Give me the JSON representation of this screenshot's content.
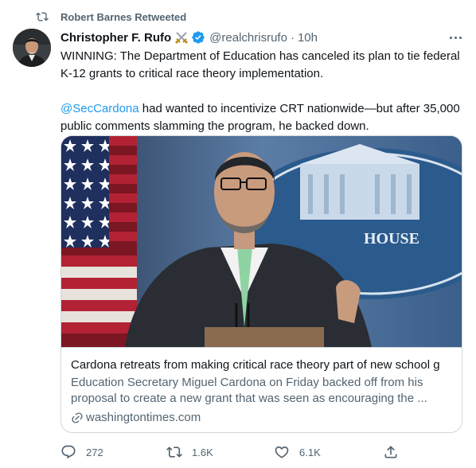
{
  "retweet": {
    "icon": "retweet-icon",
    "text": "Robert Barnes Retweeted"
  },
  "tweet": {
    "author_name": "Christopher F. Rufo",
    "author_emoji": "crossed-swords-icon",
    "verified": true,
    "handle": "@realchrisrufo",
    "separator": "·",
    "time": "10h",
    "paragraph1": "WINNING: The Department of Education has canceled its plan to tie federal K-12 grants to critical race theory implementation.",
    "mention": "@SecCardona",
    "paragraph2_rest": " had wanted to incentivize CRT nationwide—but after 35,000 public comments slamming the program, he backed down."
  },
  "card": {
    "title": "Cardona retreats from making critical race theory part of new school g",
    "description": "Education Secretary Miguel Cardona on Friday backed off from his proposal to create a new grant that was seen as encouraging the ...",
    "domain": "washingtontimes.com",
    "image_sign_text": "HOUSE"
  },
  "actions": {
    "reply": {
      "icon": "reply-icon",
      "count": "272"
    },
    "retweet": {
      "icon": "retweet-icon",
      "count": "1.6K"
    },
    "like": {
      "icon": "heart-icon",
      "count": "6.1K"
    },
    "share": {
      "icon": "share-icon"
    }
  },
  "colors": {
    "accent": "#1d9bf0",
    "secondary_text": "#536471",
    "primary_text": "#0f1419",
    "border": "#cfd9de"
  }
}
